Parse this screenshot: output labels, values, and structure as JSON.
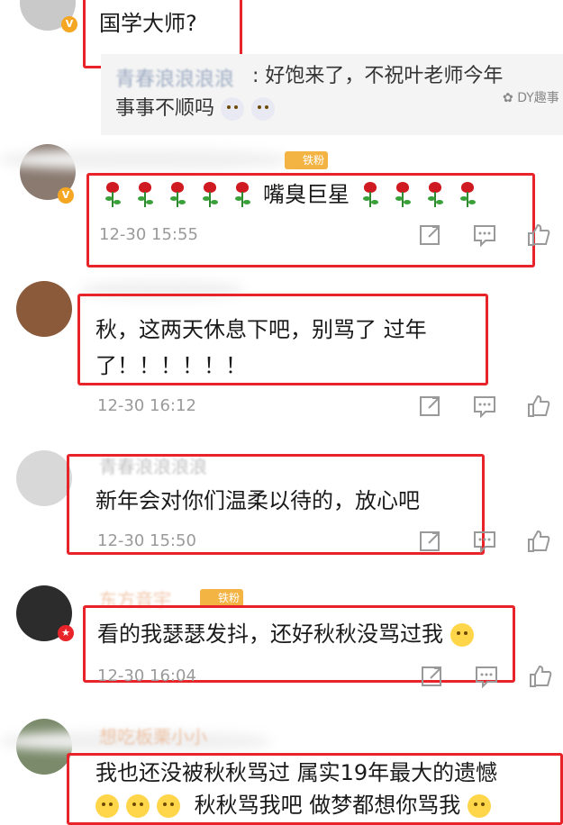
{
  "watermark": "DY趣事",
  "comments": [
    {
      "text": "国学大师?"
    },
    {
      "quote_name": "青春浪浪浪浪",
      "quote_text_1": ": 好饱来了，不祝叶老师今年",
      "quote_text_2": "事事不顺吗"
    },
    {
      "text_middle": "嘴臭巨星",
      "badge": "铁粉",
      "timestamp": "12-30 15:55"
    },
    {
      "text_1": "秋，这两天休息下吧，别骂了 过年",
      "text_2": "了！！！！！！",
      "timestamp": "12-30 16:12"
    },
    {
      "name": "青春浪浪浪浪",
      "text": "新年会对你们温柔以待的，放心吧",
      "timestamp": "12-30 15:50"
    },
    {
      "name": "东方音宇",
      "badge": "铁粉",
      "text": "看的我瑟瑟发抖，还好秋秋没骂过我",
      "timestamp": "12-30 16:04"
    },
    {
      "name": "想吃板栗小小",
      "text_1": "我也还没被秋秋骂过 属实19年最大的遗憾",
      "text_2": "秋秋骂我吧 做梦都想你骂我"
    }
  ],
  "icons": [
    "share-icon",
    "comment-icon",
    "like-icon",
    "rose-emoji",
    "flushed-emoji",
    "laugh-emoji",
    "v-badge-icon"
  ]
}
